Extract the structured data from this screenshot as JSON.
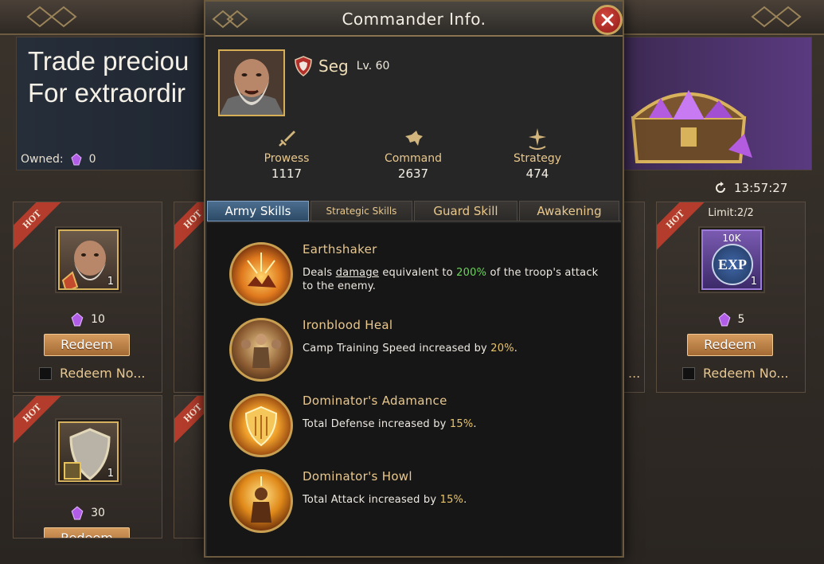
{
  "background": {
    "banner": {
      "line1": "Trade preciou",
      "line2": "For extraordir"
    },
    "owned": {
      "label": "Owned:",
      "count": "0"
    },
    "timer": "13:57:27",
    "cards": [
      {
        "ribbon": "HOT",
        "qty": "1",
        "price": "10",
        "redeem": "Redeem",
        "auto": "Redeem No..."
      },
      {
        "ribbon": "HOT"
      },
      {
        "ribbon": "HOT",
        "limit": "Limit:2/2",
        "item_top": "10K",
        "item_text": "EXP",
        "qty": "1",
        "price": "5",
        "redeem": "Redeem",
        "auto": "Redeem No...",
        "partial_auto": "..."
      },
      {
        "ribbon": "HOT",
        "qty": "1",
        "price": "30",
        "redeem": "Redeem"
      },
      {
        "ribbon": "HOT"
      }
    ]
  },
  "modal": {
    "title": "Commander Info.",
    "commander": {
      "name": "Seg",
      "level": "Lv. 60"
    },
    "stats": [
      {
        "label": "Prowess",
        "value": "1117",
        "icon": "sword-icon"
      },
      {
        "label": "Command",
        "value": "2637",
        "icon": "horse-icon"
      },
      {
        "label": "Strategy",
        "value": "474",
        "icon": "star-icon"
      }
    ],
    "tabs": [
      "Army Skills",
      "Strategic Skills",
      "Guard Skill",
      "Awakening"
    ],
    "active_tab": "Army Skills",
    "skills": [
      {
        "name": "Earthshaker",
        "desc_pre": "Deals ",
        "desc_kw": "damage",
        "desc_mid": " equivalent to ",
        "desc_val": "200%",
        "desc_post": " of the troop's attack to the enemy."
      },
      {
        "name": "Ironblood Heal",
        "desc_pre": "Camp Training Speed increased by ",
        "desc_val": "20%",
        "desc_post": "."
      },
      {
        "name": "Dominator's Adamance",
        "desc_pre": "Total Defense increased by ",
        "desc_val": "15%",
        "desc_post": "."
      },
      {
        "name": "Dominator's Howl",
        "desc_pre": "Total Attack increased by ",
        "desc_val": "15%",
        "desc_post": "."
      }
    ]
  }
}
